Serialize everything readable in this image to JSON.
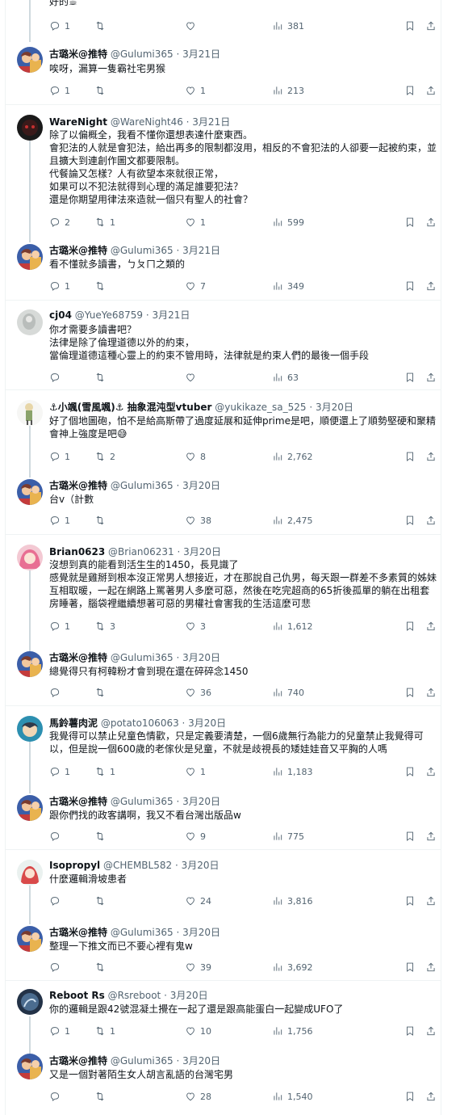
{
  "tweets": [
    {
      "name": "",
      "handle": "",
      "date": "",
      "text": "好的☕",
      "replies": "1",
      "retweets": "",
      "likes": "",
      "views": "381"
    },
    {
      "name": "古璐米@推特",
      "handle": "@Gulumi365",
      "date": "3月21日",
      "text": "唉呀，漏算一隻霸社宅男猴",
      "replies": "1",
      "retweets": "",
      "likes": "1",
      "views": "213"
    },
    {
      "name": "WareNight",
      "handle": "@WareNight46",
      "date": "3月21日",
      "text": "除了以偏概全，我看不懂你還想表達什麼東西。\n會犯法的人就是會犯法，給出再多的限制都沒用，相反的不會犯法的人卻要一起被約束，並且擴大到連創作圖文都要限制。\n代餐論又怎樣？人有欲望本來就很正常，\n如果可以不犯法就得到心理的滿足誰要犯法？\n還是你期望用律法來造就一個只有聖人的社會？",
      "replies": "2",
      "retweets": "1",
      "likes": "1",
      "views": "599"
    },
    {
      "name": "古璐米@推特",
      "handle": "@Gulumi365",
      "date": "3月21日",
      "text": "看不懂就多讀書，ㄅㄆㄇ之類的",
      "replies": "1",
      "retweets": "",
      "likes": "7",
      "views": "349"
    },
    {
      "name": "cj04",
      "handle": "@YueYe68759",
      "date": "3月21日",
      "text": "你才需要多讀書吧？\n法律是除了倫理道德以外的約束，\n當倫理道德這種心靈上的約束不管用時，法律就是約束人們的最後一個手段",
      "replies": "",
      "retweets": "",
      "likes": "",
      "views": "63"
    },
    {
      "name": "⚓小颯(雪風颯)⚓ 抽象混沌型vtuber",
      "handle": "@yukikaze_sa_525",
      "date": "3月20日",
      "text": "好了個地圖砲，怕不是給高斯帶了過度延展和延伸prime是吧，順便還上了順勢堅硬和聚精會神上強度是吧😅",
      "replies": "1",
      "retweets": "2",
      "likes": "8",
      "views": "2,762"
    },
    {
      "name": "古璐米@推特",
      "handle": "@Gulumi365",
      "date": "3月20日",
      "text": "台v（計數",
      "replies": "1",
      "retweets": "",
      "likes": "38",
      "views": "2,475"
    },
    {
      "name": "Brian0623",
      "handle": "@Brian06231",
      "date": "3月20日",
      "text": "沒想到真的能看到活生生的1450，長見識了\n感覺就是雞掰到根本沒正常男人想接近，才在那說自己仇男，每天跟一群差不多素質的姊妹互相取暖，一起在網路上罵著男人多麼可惡，然後在吃完超商的65折後孤單的躺在出租套房睡著，腦袋裡繼續想著可惡的男權社會害我的生活這麼可悲",
      "replies": "1",
      "retweets": "3",
      "likes": "3",
      "views": "1,612"
    },
    {
      "name": "古璐米@推特",
      "handle": "@Gulumi365",
      "date": "3月20日",
      "text": "總覺得只有柯韓粉才會到現在還在碎碎念1450",
      "replies": "",
      "retweets": "",
      "likes": "36",
      "views": "740"
    },
    {
      "name": "馬鈴薯肉泥",
      "handle": "@potato106063",
      "date": "3月20日",
      "text": "我覺得可以禁止兒童色情歡，只是定義要清楚，一個6歲無行為能力的兒童禁止我覺得可以，但是說一個600歲的老傢伙是兒童，不就是歧視長的矮娃娃音又平胸的人嗎",
      "replies": "1",
      "retweets": "1",
      "likes": "1",
      "views": "1,183"
    },
    {
      "name": "古璐米@推特",
      "handle": "@Gulumi365",
      "date": "3月20日",
      "text": "跟你們找的政客講啊，我又不看台灣出版品w",
      "replies": "",
      "retweets": "",
      "likes": "9",
      "views": "775"
    },
    {
      "name": "Isopropyl",
      "handle": "@CHEMBL582",
      "date": "3月20日",
      "text": "什麼邏輯滑坡患者",
      "replies": "",
      "retweets": "",
      "likes": "24",
      "views": "3,816"
    },
    {
      "name": "古璐米@推特",
      "handle": "@Gulumi365",
      "date": "3月20日",
      "text": "整理一下推文而已不要心裡有鬼w",
      "replies": "",
      "retweets": "",
      "likes": "39",
      "views": "3,692"
    },
    {
      "name": "Reboot Rs",
      "handle": "@Rsreboot",
      "date": "3月20日",
      "text": "你的邏輯是跟42號混凝土攪在一起了還是跟高能蛋白一起變成UFO了",
      "replies": "1",
      "retweets": "1",
      "likes": "10",
      "views": "1,756"
    },
    {
      "name": "古璐米@推特",
      "handle": "@Gulumi365",
      "date": "3月20日",
      "text": "又是一個對著陌生女人胡言亂語的台灣宅男",
      "replies": "",
      "retweets": "",
      "likes": "28",
      "views": "1,540"
    }
  ],
  "icons": {
    "reply": "reply-icon",
    "retweet": "retweet-icon",
    "like": "heart-icon",
    "views": "views-icon",
    "bookmark": "bookmark-icon",
    "share": "share-icon"
  },
  "colors": {
    "text": "#0f1419",
    "muted": "#536471",
    "border": "#eff3f4",
    "thread": "#cfd9de"
  }
}
